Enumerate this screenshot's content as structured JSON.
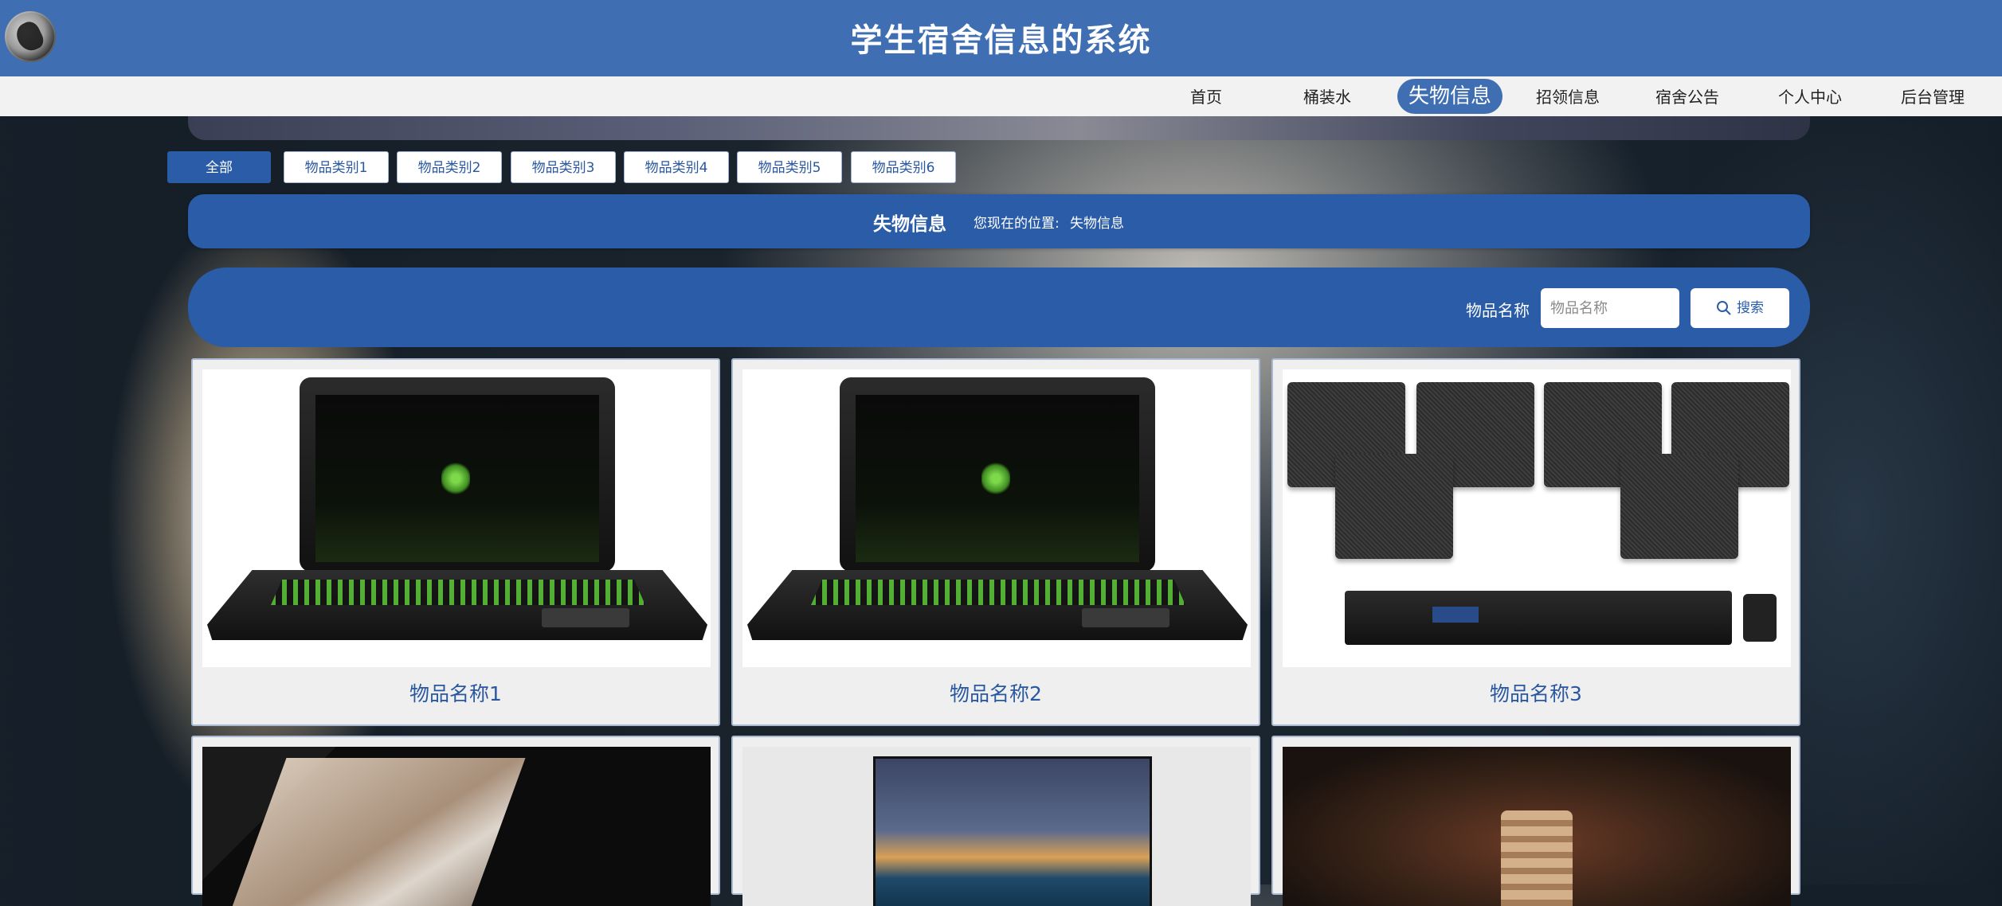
{
  "header": {
    "title": "学生宿舍信息的系统"
  },
  "nav": {
    "items": [
      {
        "label": "首页"
      },
      {
        "label": "桶装水"
      },
      {
        "label": "失物信息",
        "active": true
      },
      {
        "label": "招领信息"
      },
      {
        "label": "宿舍公告"
      },
      {
        "label": "个人中心"
      },
      {
        "label": "后台管理"
      }
    ]
  },
  "categories": [
    {
      "label": "全部",
      "active": true
    },
    {
      "label": "物品类别1"
    },
    {
      "label": "物品类别2"
    },
    {
      "label": "物品类别3"
    },
    {
      "label": "物品类别4"
    },
    {
      "label": "物品类别5"
    },
    {
      "label": "物品类别6"
    }
  ],
  "breadcrumb": {
    "title": "失物信息",
    "location_label": "您现在的位置:",
    "current": "失物信息"
  },
  "search": {
    "label": "物品名称",
    "placeholder": "物品名称",
    "button_label": "搜索"
  },
  "items": [
    {
      "name": "物品名称1",
      "image": "laptop-image"
    },
    {
      "name": "物品名称2",
      "image": "laptop-image"
    },
    {
      "name": "物品名称3",
      "image": "speakers-image"
    },
    {
      "name": "",
      "image": "laptop-image"
    },
    {
      "name": "",
      "image": "tv-image"
    },
    {
      "name": "",
      "image": "watch-image"
    }
  ],
  "colors": {
    "primary": "#2a5ca8",
    "header": "#3f6fb2",
    "nav_bg": "#f2f2f2",
    "card_bg": "#efefef"
  }
}
